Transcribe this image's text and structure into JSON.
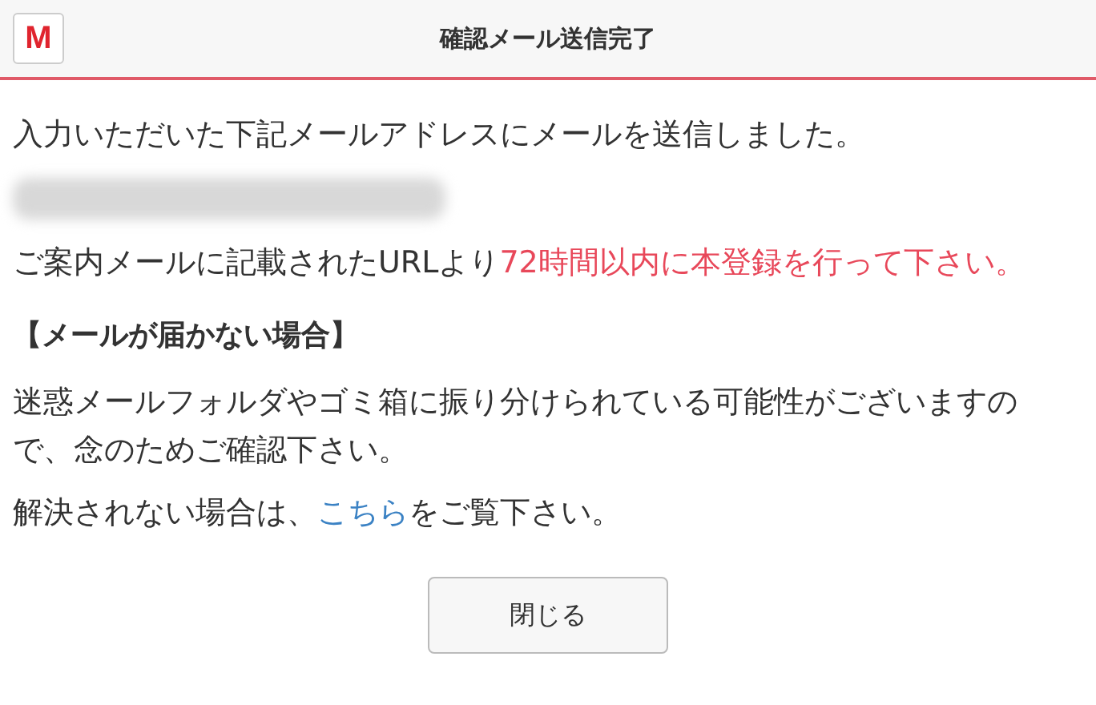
{
  "header": {
    "logo": "M",
    "title": "確認メール送信完了"
  },
  "message": "入力いただいた下記メールアドレスにメールを送信しました。",
  "email": {
    "kind": "blurred"
  },
  "instruction": {
    "text": "ご案内メールに記載されたURLより",
    "highlight": "72時間以内に本登録を行って下さい。"
  },
  "section_heading": "【メールが届かない場合】",
  "section_text": "迷惑メールフォルダやゴミ箱に振り分けられている可能性がございますので、念のためご確認下さい。",
  "help": {
    "before": "解決されない場合は、",
    "link": "こちら",
    "after": "をご覧下さい。"
  },
  "buttons": [
    "閉じる"
  ]
}
